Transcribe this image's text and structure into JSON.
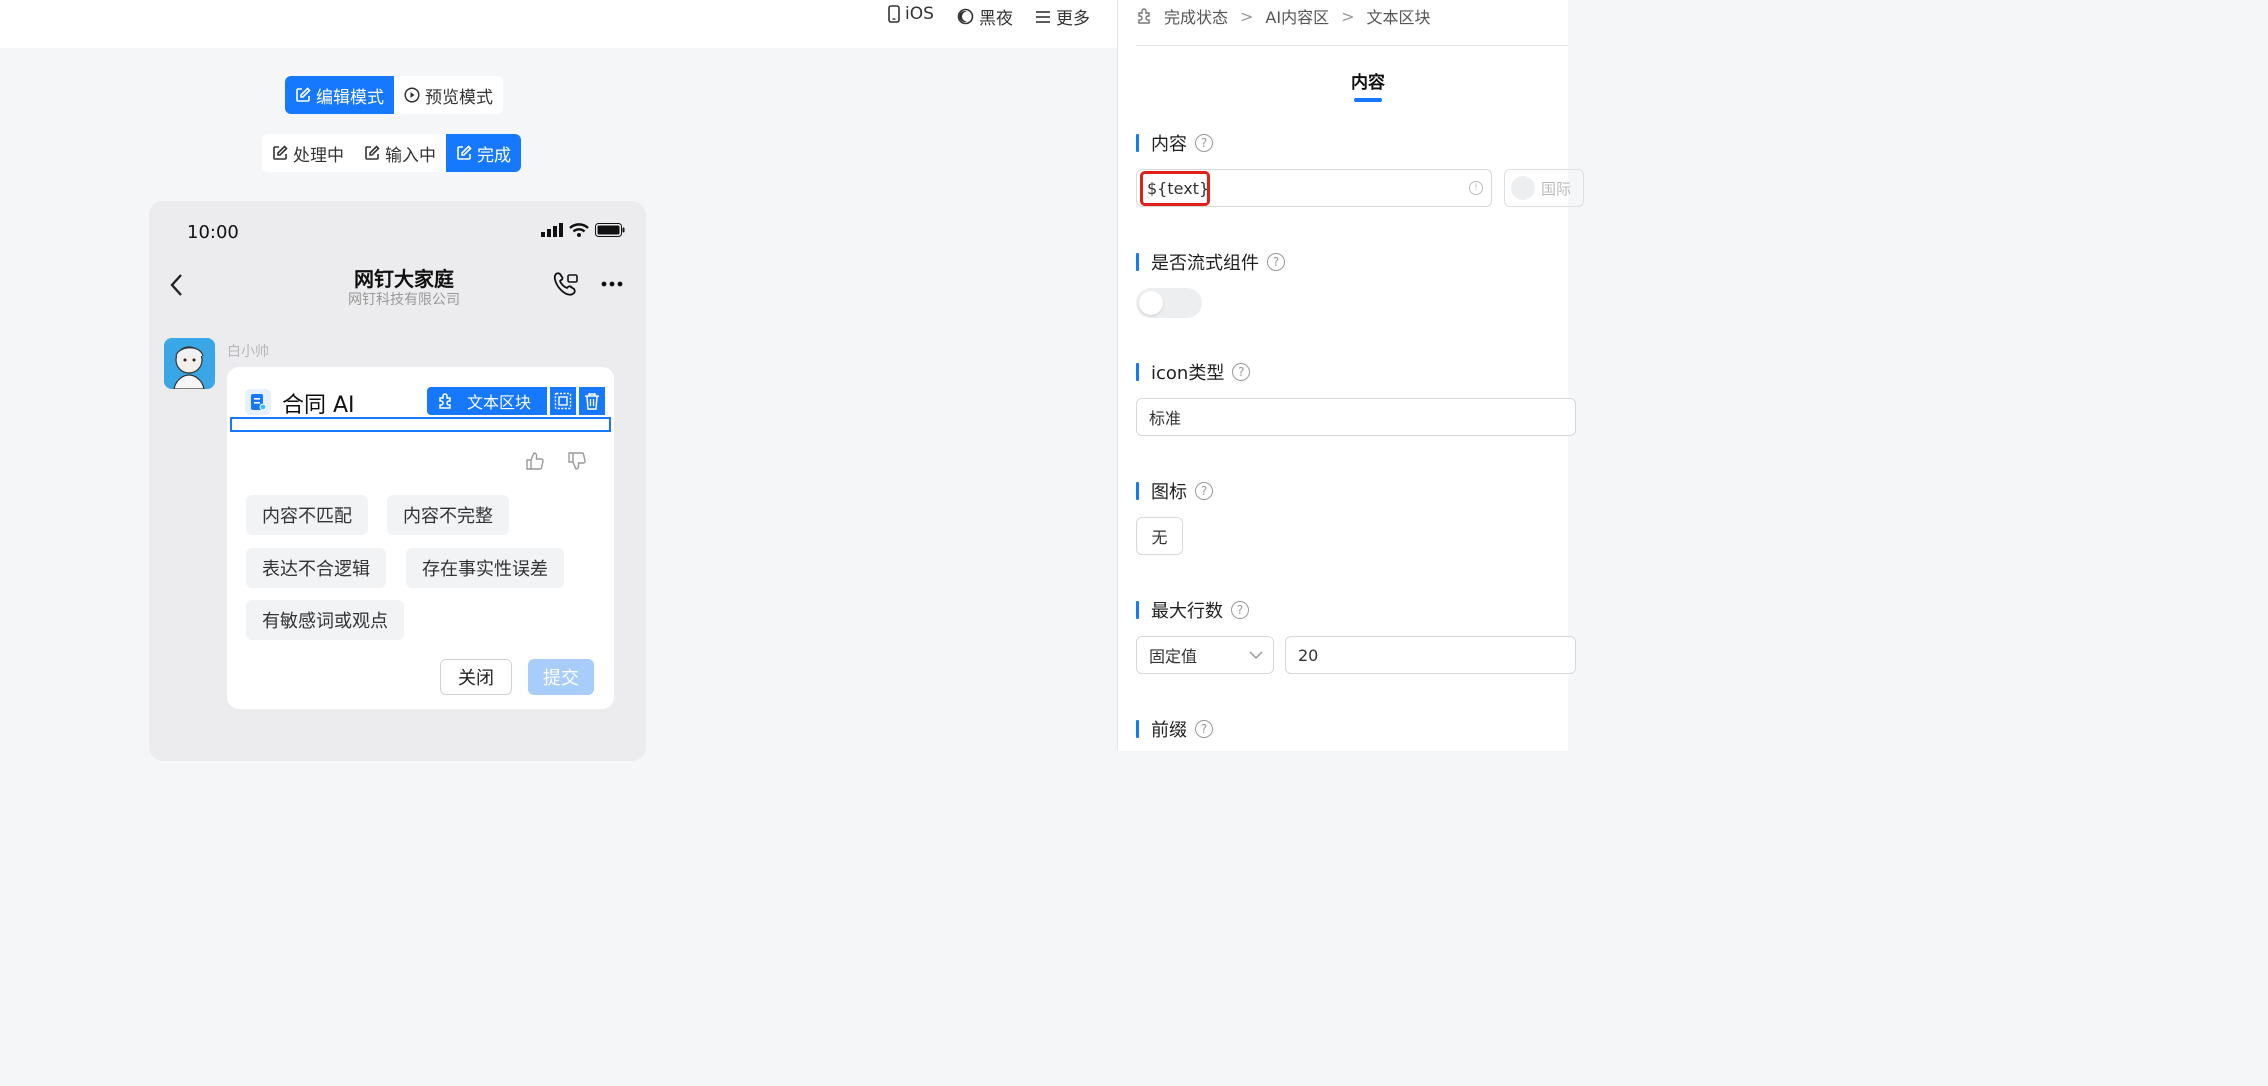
{
  "topbar": {
    "ios_label": "iOS",
    "dark_label": "黑夜",
    "more_label": "更多"
  },
  "mode_switch": {
    "edit_label": "编辑模式",
    "preview_label": "预览模式"
  },
  "status_switch": {
    "processing_label": "处理中",
    "inputting_label": "输入中",
    "done_label": "完成"
  },
  "phone": {
    "time": "10:00",
    "chat_title": "网钉大家庭",
    "chat_subtitle": "网钉科技有限公司",
    "sender_name": "白小帅",
    "card_title": "合同 AI",
    "selected_block_label": "文本区块",
    "feedback_tags": [
      "内容不匹配",
      "内容不完整",
      "表达不合逻辑",
      "存在事实性误差",
      "有敏感词或观点"
    ],
    "close_label": "关闭",
    "submit_label": "提交"
  },
  "panel": {
    "breadcrumb": [
      "完成状态",
      "AI内容区",
      "文本区块"
    ],
    "tab_label": "内容",
    "content_label": "内容",
    "content_value": "${text}",
    "intl_label": "国际",
    "stream_label": "是否流式组件",
    "icon_type_label": "icon类型",
    "icon_type_value": "标准",
    "icon_label": "图标",
    "icon_value": "无",
    "max_lines_label": "最大行数",
    "max_lines_mode": "固定值",
    "max_lines_value": "20",
    "prefix_label": "前缀"
  },
  "colors": {
    "accent": "#1677ff",
    "highlight_border": "#e0201a"
  }
}
